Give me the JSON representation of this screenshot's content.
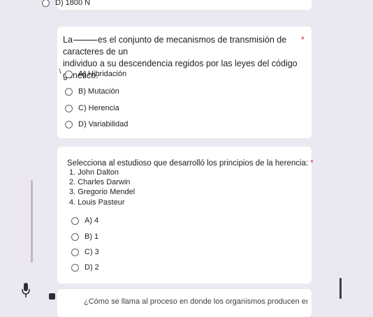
{
  "previous_option": {
    "label": "D) 1800 N"
  },
  "question1": {
    "text_before": "La",
    "text_after": "es el conjunto de mecanismos de transmisión de caracteres de un",
    "text_line2": "individuo a su descendencia regidos por las leyes del código genético.",
    "required_mark": "*",
    "options": [
      {
        "label": "A) Hibridación"
      },
      {
        "label": "B) Mutación"
      },
      {
        "label": "C) Herencia"
      },
      {
        "label": "D) Variabilidad"
      }
    ]
  },
  "question2": {
    "text": "Selecciona al estudioso que desarrolló los principios de la herencia:",
    "required_mark": "*",
    "list": [
      "1. John Dalton",
      "2. Charles Darwin",
      "3. Gregorio Mendel",
      "4. Louis Pasteur"
    ],
    "options": [
      {
        "label": "A) 4"
      },
      {
        "label": "B) 1"
      },
      {
        "label": "C) 3"
      },
      {
        "label": "D) 2"
      }
    ]
  },
  "question3": {
    "text": "¿Cómo se llama al proceso en donde los organismos producen energía por medio ?"
  },
  "icons": {
    "mic": "microphone-icon",
    "radio": "radio-button-icon"
  },
  "colors": {
    "background": "#ece8f1",
    "card": "#ffffff",
    "required": "#d93025"
  }
}
